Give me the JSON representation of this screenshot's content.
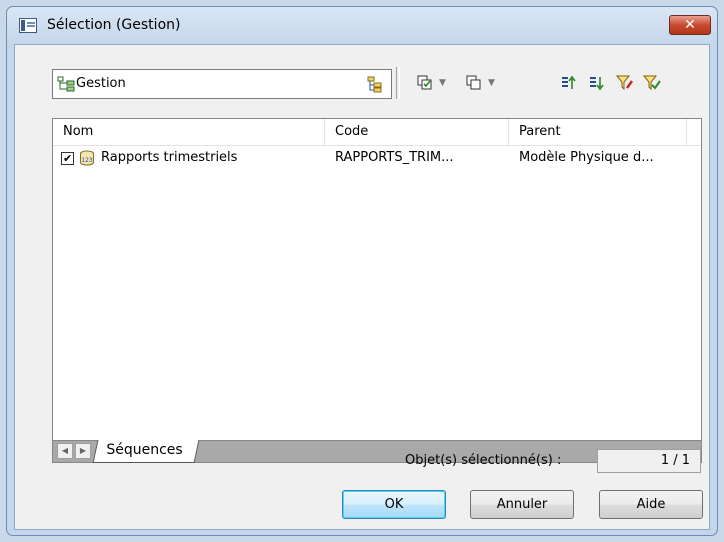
{
  "window": {
    "title": "Sélection (Gestion)",
    "close_label": "✕"
  },
  "scope": {
    "value": "Gestion"
  },
  "list": {
    "columns": [
      "Nom",
      "Code",
      "Parent"
    ],
    "rows": [
      {
        "checked": true,
        "icon": "sequence-icon",
        "name": "Rapports trimestriels",
        "code": "RAPPORTS_TRIM...",
        "parent": "Modèle Physique d..."
      }
    ]
  },
  "tabs": [
    {
      "label": "Séquences"
    }
  ],
  "selection": {
    "label": "Objet(s) sélectionné(s) :",
    "value": "1 / 1"
  },
  "buttons": {
    "ok": "OK",
    "cancel": "Annuler",
    "help": "Aide"
  }
}
